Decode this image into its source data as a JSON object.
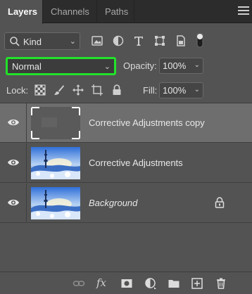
{
  "tabs": [
    {
      "label": "Layers",
      "active": true
    },
    {
      "label": "Channels",
      "active": false
    },
    {
      "label": "Paths",
      "active": false
    }
  ],
  "filter": {
    "kind_label": "Kind",
    "icons": [
      "pixel-filter-icon",
      "adjustment-filter-icon",
      "type-filter-icon",
      "shape-filter-icon",
      "smart-object-filter-icon",
      "filter-toggle-icon"
    ]
  },
  "blend": {
    "mode": "Normal",
    "highlight_color": "#22e12a",
    "opacity_label": "Opacity:",
    "opacity_value": "100%"
  },
  "lock": {
    "label": "Lock:",
    "icons": [
      "lock-transparent-pixels-icon",
      "lock-image-pixels-icon",
      "lock-position-icon",
      "lock-artboard-icon",
      "lock-all-icon"
    ],
    "fill_label": "Fill:",
    "fill_value": "100%"
  },
  "layers": [
    {
      "name": "Corrective Adjustments copy",
      "selected": true,
      "italic": false,
      "thumb": "gray-placeholder",
      "locked": false
    },
    {
      "name": "Corrective Adjustments",
      "selected": false,
      "italic": false,
      "thumb": "winter-photo",
      "locked": false
    },
    {
      "name": "Background",
      "selected": false,
      "italic": true,
      "thumb": "winter-photo",
      "locked": true
    }
  ],
  "bottom_tools": [
    "link-layers-icon",
    "fx-icon",
    "add-mask-icon",
    "new-adjustment-layer-icon",
    "new-group-icon",
    "new-layer-icon",
    "delete-layer-icon"
  ],
  "fx_label": "fx"
}
